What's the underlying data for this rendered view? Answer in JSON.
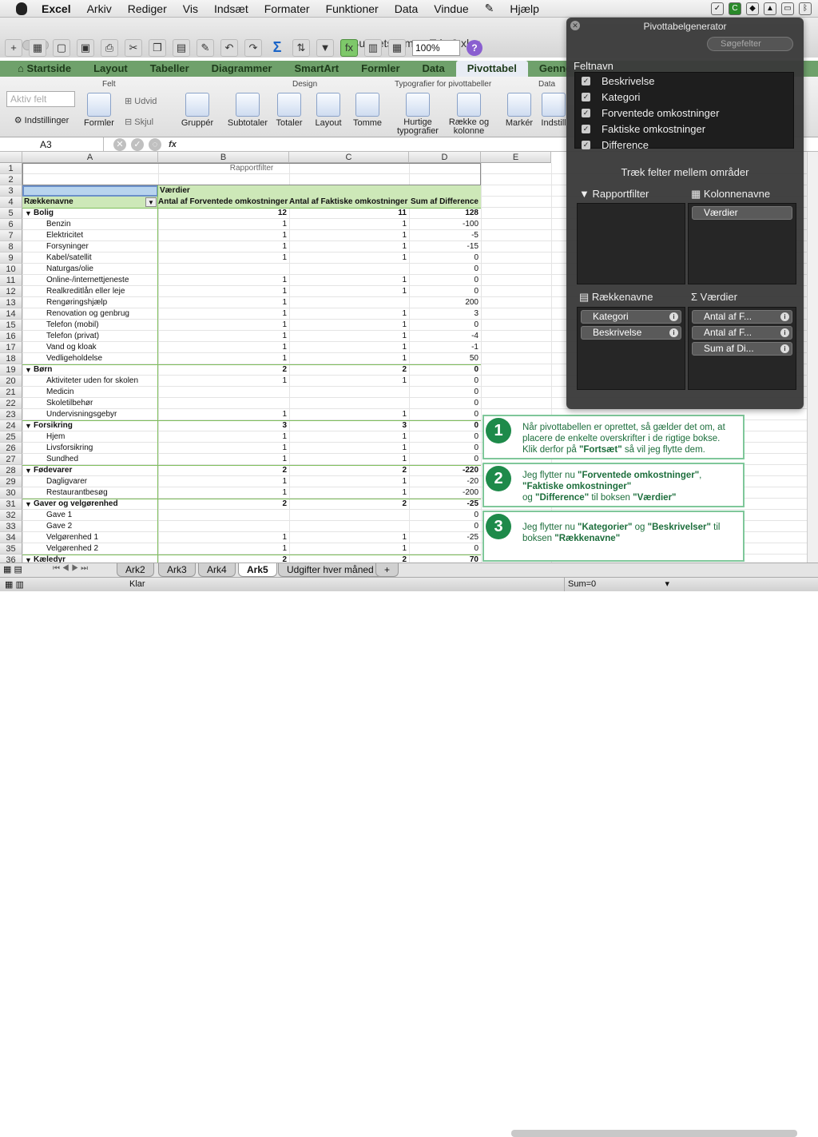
{
  "menubar": {
    "app": "Excel",
    "items": [
      "Arkiv",
      "Rediger",
      "Vis",
      "Indsæt",
      "Formater",
      "Funktioner",
      "Data",
      "Vindue",
      "",
      "Hjælp"
    ]
  },
  "window": {
    "title": "Budgetskema - Trin 2.xlsx"
  },
  "toolbar": {
    "zoom": "100%"
  },
  "tabs": [
    "Startside",
    "Layout",
    "Tabeller",
    "Diagrammer",
    "SmartArt",
    "Formler",
    "Data",
    "Pivottabel",
    "Genne"
  ],
  "ribbon": {
    "groups": {
      "felt": "Felt",
      "design": "Design",
      "typo": "Typografier for pivottabeller",
      "data": "Data"
    },
    "aktiv_felt": "Aktiv felt",
    "indstillinger": "Indstillinger",
    "formler": "Formler",
    "udvid": "Udvid",
    "skjul": "Skjul",
    "grupper": "Gruppér",
    "subtotaler": "Subtotaler",
    "totaler": "Totaler",
    "layout": "Layout",
    "tomme": "Tomme",
    "hurtige1": "Hurtige",
    "hurtige2": "typografier",
    "raekke1": "Række og",
    "raekke2": "kolonne",
    "marker": "Markér",
    "indstil": "Indstill"
  },
  "formula": {
    "cellref": "A3",
    "fx": "fx"
  },
  "columns": [
    "A",
    "B",
    "C",
    "D",
    "E"
  ],
  "rapportfilter": "Rapportfilter",
  "pivot_header": {
    "vaerdier": "Værdier",
    "rk": "Rækkenavne",
    "b": "Antal af Forventede omkostninger",
    "c": "Antal af Faktiske omkostninger",
    "d": "Sum af Difference"
  },
  "rows": [
    {
      "n": "5",
      "a": "Bolig",
      "b": "12",
      "c": "11",
      "d": "128",
      "g": 1
    },
    {
      "n": "6",
      "a": "Benzin",
      "b": "1",
      "c": "1",
      "d": "-100"
    },
    {
      "n": "7",
      "a": "Elektricitet",
      "b": "1",
      "c": "1",
      "d": "-5"
    },
    {
      "n": "8",
      "a": "Forsyninger",
      "b": "1",
      "c": "1",
      "d": "-15"
    },
    {
      "n": "9",
      "a": "Kabel/satellit",
      "b": "1",
      "c": "1",
      "d": "0"
    },
    {
      "n": "10",
      "a": "Naturgas/olie",
      "b": "",
      "c": "",
      "d": "0"
    },
    {
      "n": "11",
      "a": "Online-/internettjeneste",
      "b": "1",
      "c": "1",
      "d": "0"
    },
    {
      "n": "12",
      "a": "Realkreditlån eller leje",
      "b": "1",
      "c": "1",
      "d": "0"
    },
    {
      "n": "13",
      "a": "Rengøringshjælp",
      "b": "1",
      "c": "",
      "d": "200"
    },
    {
      "n": "14",
      "a": "Renovation og genbrug",
      "b": "1",
      "c": "1",
      "d": "3"
    },
    {
      "n": "15",
      "a": "Telefon (mobil)",
      "b": "1",
      "c": "1",
      "d": "0"
    },
    {
      "n": "16",
      "a": "Telefon (privat)",
      "b": "1",
      "c": "1",
      "d": "-4"
    },
    {
      "n": "17",
      "a": "Vand og kloak",
      "b": "1",
      "c": "1",
      "d": "-1"
    },
    {
      "n": "18",
      "a": "Vedligeholdelse",
      "b": "1",
      "c": "1",
      "d": "50"
    },
    {
      "n": "19",
      "a": "Børn",
      "b": "2",
      "c": "2",
      "d": "0",
      "g": 1
    },
    {
      "n": "20",
      "a": "Aktiviteter uden for skolen",
      "b": "1",
      "c": "1",
      "d": "0"
    },
    {
      "n": "21",
      "a": "Medicin",
      "b": "",
      "c": "",
      "d": "0"
    },
    {
      "n": "22",
      "a": "Skoletilbehør",
      "b": "",
      "c": "",
      "d": "0"
    },
    {
      "n": "23",
      "a": "Undervisningsgebyr",
      "b": "1",
      "c": "1",
      "d": "0"
    },
    {
      "n": "24",
      "a": "Forsikring",
      "b": "3",
      "c": "3",
      "d": "0",
      "g": 1
    },
    {
      "n": "25",
      "a": "Hjem",
      "b": "1",
      "c": "1",
      "d": "0"
    },
    {
      "n": "26",
      "a": "Livsforsikring",
      "b": "1",
      "c": "1",
      "d": "0"
    },
    {
      "n": "27",
      "a": "Sundhed",
      "b": "1",
      "c": "1",
      "d": "0"
    },
    {
      "n": "28",
      "a": "Fødevarer",
      "b": "2",
      "c": "2",
      "d": "-220",
      "g": 1
    },
    {
      "n": "29",
      "a": "Dagligvarer",
      "b": "1",
      "c": "1",
      "d": "-20"
    },
    {
      "n": "30",
      "a": "Restaurantbesøg",
      "b": "1",
      "c": "1",
      "d": "-200"
    },
    {
      "n": "31",
      "a": "Gaver og velgørenhed",
      "b": "2",
      "c": "2",
      "d": "-25",
      "g": 1
    },
    {
      "n": "32",
      "a": "Gave 1",
      "b": "",
      "c": "",
      "d": "0"
    },
    {
      "n": "33",
      "a": "Gave 2",
      "b": "",
      "c": "",
      "d": "0"
    },
    {
      "n": "34",
      "a": "Velgørenhed 1",
      "b": "1",
      "c": "1",
      "d": "-25"
    },
    {
      "n": "35",
      "a": "Velgørenhed 2",
      "b": "1",
      "c": "1",
      "d": "0"
    },
    {
      "n": "36",
      "a": "Kæledyr",
      "b": "2",
      "c": "2",
      "d": "70",
      "g": 1
    }
  ],
  "panel": {
    "title": "Pivottabelgenerator",
    "search": "Søgefelter",
    "feltnavn": "Feltnavn",
    "fields": [
      "Beskrivelse",
      "Kategori",
      "Forventede omkostninger",
      "Faktiske omkostninger",
      "Difference"
    ],
    "drag": "Træk felter mellem områder",
    "rapportfilter": "Rapportfilter",
    "kolonnenavne": "Kolonnenavne",
    "raekkenavne": "Rækkenavne",
    "vaerdier": "Værdier",
    "kol_items": [
      "Værdier"
    ],
    "raekke_items": [
      "Kategori",
      "Beskrivelse"
    ],
    "vaerdi_items": [
      "Antal af F...",
      "Antal af F...",
      "Sum af Di..."
    ]
  },
  "notes": [
    {
      "num": "1",
      "l1": "Når pivottabellen er oprettet, så gælder det om, at",
      "l2": "placere de enkelte overskrifter i de rigtige bokse.",
      "l3a": "Klik derfor på ",
      "l3b": "\"Fortsæt\"",
      "l3c": " så vil jeg flytte dem."
    },
    {
      "num": "2",
      "l1a": "Jeg flytter nu ",
      "l1b": "\"Forventede omkostninger\"",
      "l1c": ",",
      "l2": "\"Faktiske omkostninger\"",
      "l3a": "og ",
      "l3b": "\"Difference\"",
      "l3c": " til boksen ",
      "l3d": "\"Værdier\""
    },
    {
      "num": "3",
      "l1a": "Jeg flytter nu ",
      "l1b": "\"Kategorier\"",
      "l1c": " og ",
      "l1d": "\"Beskrivelser\"",
      "l1e": " til",
      "l2a": "boksen ",
      "l2b": "\"Rækkenavne\""
    }
  ],
  "sheets": [
    "Ark2",
    "Ark3",
    "Ark4",
    "Ark5",
    "Udgifter hver måned"
  ],
  "status": {
    "ready": "Klar",
    "sum": "Sum=0"
  }
}
